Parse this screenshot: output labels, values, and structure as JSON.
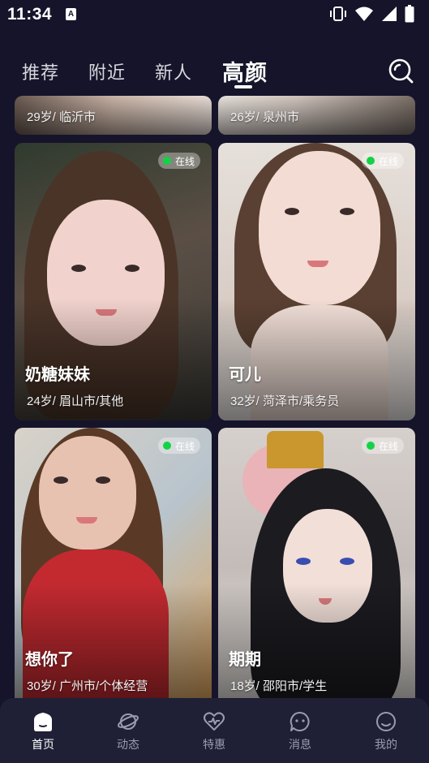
{
  "status_bar": {
    "time": "11:34",
    "badge": "A"
  },
  "tabs": [
    {
      "label": "推荐",
      "active": false
    },
    {
      "label": "附近",
      "active": false
    },
    {
      "label": "新人",
      "active": false
    },
    {
      "label": "高颜",
      "active": true
    }
  ],
  "partial_cards": [
    {
      "info": "29岁/ 临沂市"
    },
    {
      "info": "26岁/ 泉州市"
    }
  ],
  "cards": [
    {
      "name": "奶糖妹妹",
      "info": "24岁/ 眉山市/其他",
      "online_label": "在线"
    },
    {
      "name": "可儿",
      "info": "32岁/ 菏泽市/乘务员",
      "online_label": "在线"
    },
    {
      "name": "想你了",
      "info": "30岁/ 广州市/个体经营",
      "online_label": "在线"
    },
    {
      "name": "期期",
      "info": "18岁/ 邵阳市/学生",
      "online_label": "在线"
    }
  ],
  "bottom_nav": [
    {
      "label": "首页",
      "icon": "home-icon",
      "active": true
    },
    {
      "label": "动态",
      "icon": "planet-icon",
      "active": false
    },
    {
      "label": "特惠",
      "icon": "heart-pulse-icon",
      "active": false
    },
    {
      "label": "消息",
      "icon": "chat-bubble-icon",
      "active": false
    },
    {
      "label": "我的",
      "icon": "profile-smile-icon",
      "active": false
    }
  ],
  "colors": {
    "background": "#15142a",
    "nav_background": "#1f2036",
    "online_dot": "#13d245"
  }
}
